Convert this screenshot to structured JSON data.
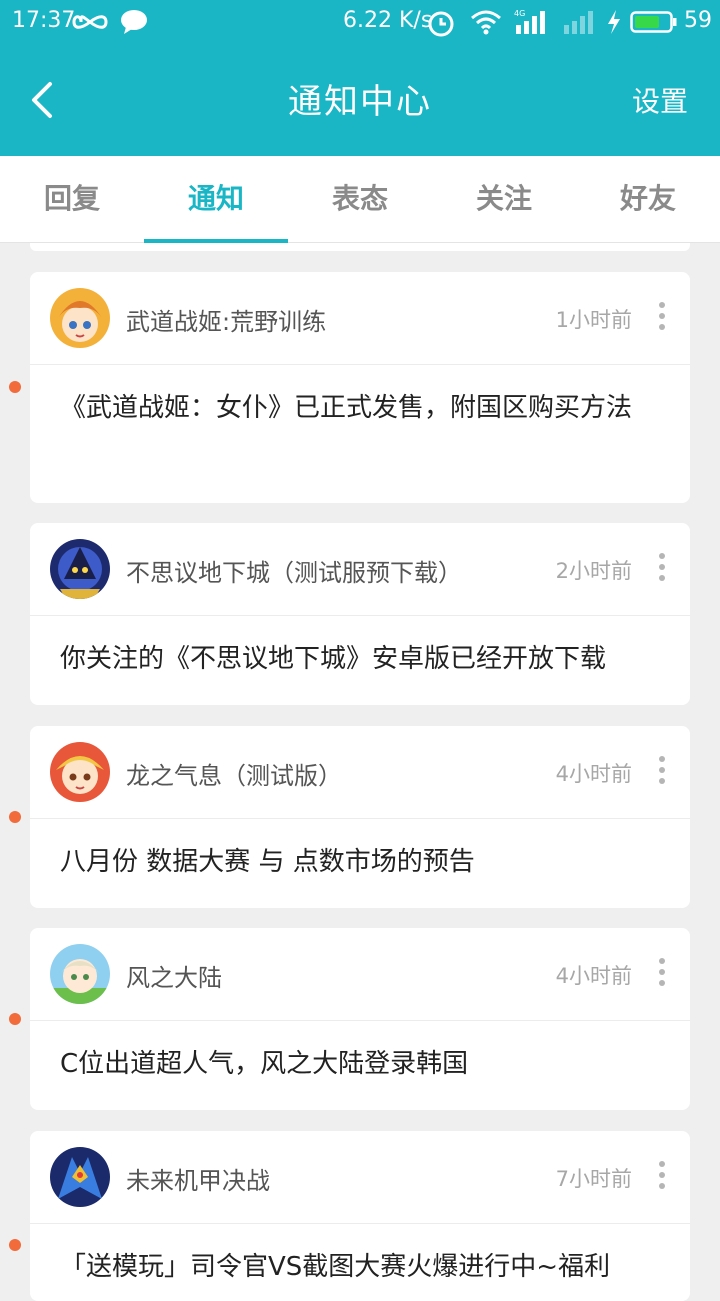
{
  "status_bar": {
    "time": "17:37",
    "speed": "6.22 K/s",
    "network": "4G",
    "battery": "59",
    "icons": [
      "infinity-icon",
      "chat-bubble-icon",
      "alarm-icon",
      "wifi-icon",
      "signal-icon",
      "charging-icon",
      "battery-icon"
    ]
  },
  "header": {
    "title": "通知中心",
    "settings_label": "设置",
    "back_icon": "back-arrow-icon"
  },
  "tabs": [
    {
      "label": "回复"
    },
    {
      "label": "通知",
      "active": true
    },
    {
      "label": "表态"
    },
    {
      "label": "关注"
    },
    {
      "label": "好友"
    }
  ],
  "notifications": [
    {
      "name": "武道战姬:荒野训练",
      "time": "1小时前",
      "message": "《武道战姬：女仆》已正式发售，附国区购买方法",
      "unread": true
    },
    {
      "name": "不思议地下城（测试服预下载）",
      "time": "2小时前",
      "message": "你关注的《不思议地下城》安卓版已经开放下载",
      "unread": false
    },
    {
      "name": "龙之气息（测试版）",
      "time": "4小时前",
      "message": "八月份 数据大赛 与 点数市场的预告",
      "unread": true
    },
    {
      "name": "风之大陆",
      "time": "4小时前",
      "message": "C位出道超人气，风之大陆登录韩国",
      "unread": true
    },
    {
      "name": "未来机甲决战",
      "time": "7小时前",
      "message": "「送模玩」司令官VS截图大赛火爆进行中~福利",
      "unread": true
    }
  ],
  "colors": {
    "accent": "#1ab6c6",
    "unread_dot": "#f26b3a",
    "background": "#efefef"
  }
}
